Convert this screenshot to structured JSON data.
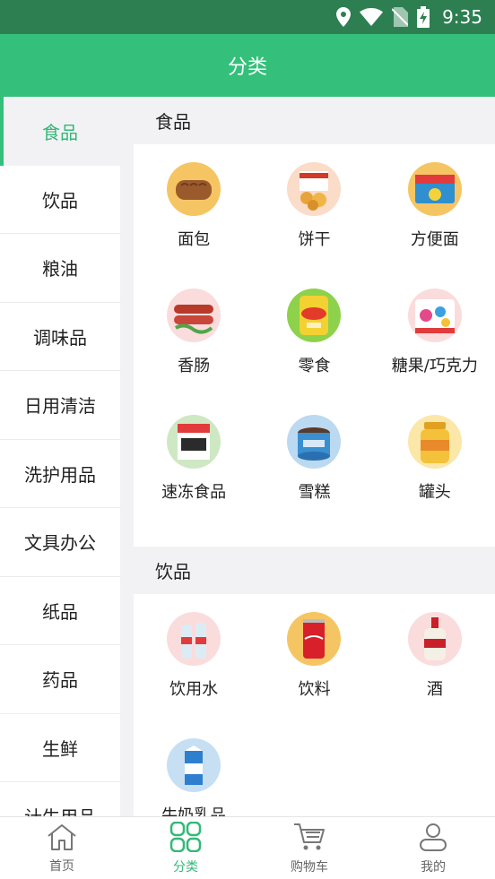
{
  "status": {
    "time": "9:35",
    "icons": [
      "location-icon",
      "wifi-icon",
      "no-sim-icon",
      "battery-charging-icon"
    ]
  },
  "header": {
    "title": "分类"
  },
  "sidebar": {
    "items": [
      {
        "label": "食品"
      },
      {
        "label": "饮品"
      },
      {
        "label": "粮油"
      },
      {
        "label": "调味品"
      },
      {
        "label": "日用清洁"
      },
      {
        "label": "洗护用品"
      },
      {
        "label": "文具办公"
      },
      {
        "label": "纸品"
      },
      {
        "label": "药品"
      },
      {
        "label": "生鲜"
      },
      {
        "label": "计生用品"
      }
    ]
  },
  "sections": [
    {
      "title": "食品",
      "items": [
        {
          "label": "面包"
        },
        {
          "label": "饼干"
        },
        {
          "label": "方便面"
        },
        {
          "label": "香肠"
        },
        {
          "label": "零食"
        },
        {
          "label": "糖果/巧克力"
        },
        {
          "label": "速冻食品"
        },
        {
          "label": "雪糕"
        },
        {
          "label": "罐头"
        }
      ]
    },
    {
      "title": "饮品",
      "items": [
        {
          "label": "饮用水"
        },
        {
          "label": "饮料"
        },
        {
          "label": "酒"
        },
        {
          "label": "牛奶乳品"
        }
      ]
    }
  ],
  "tabbar": {
    "items": [
      {
        "label": "首页",
        "icon": "home-icon"
      },
      {
        "label": "分类",
        "icon": "category-grid-icon"
      },
      {
        "label": "购物车",
        "icon": "cart-icon"
      },
      {
        "label": "我的",
        "icon": "user-icon"
      }
    ]
  },
  "colors": {
    "accent": "#34c07a",
    "status_bar": "#2d7f52",
    "active_text": "#34b878"
  }
}
